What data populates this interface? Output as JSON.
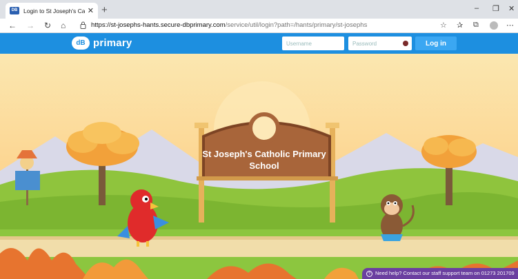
{
  "browser": {
    "tab_title": "Login to St Joseph's Catholic Prim",
    "tab_favicon": "DB",
    "url_host": "https://st-josephs-hants.secure-dbprimary.com",
    "url_path": "/service/util/login?path=/hants/primary/st-josephs"
  },
  "header": {
    "logo_badge": "dB",
    "logo_text": "primary",
    "username_placeholder": "Username",
    "password_placeholder": "Password",
    "login_label": "Log in"
  },
  "sign": {
    "line1": "St Joseph's Catholic Primary",
    "line2": "School"
  },
  "help": {
    "icon": "?",
    "text": "Need help? Contact our staff support team on 01273 201709"
  },
  "colors": {
    "header_blue": "#1d8fe0",
    "button_blue": "#3ba7f2",
    "help_purple": "#6b3fa0"
  }
}
